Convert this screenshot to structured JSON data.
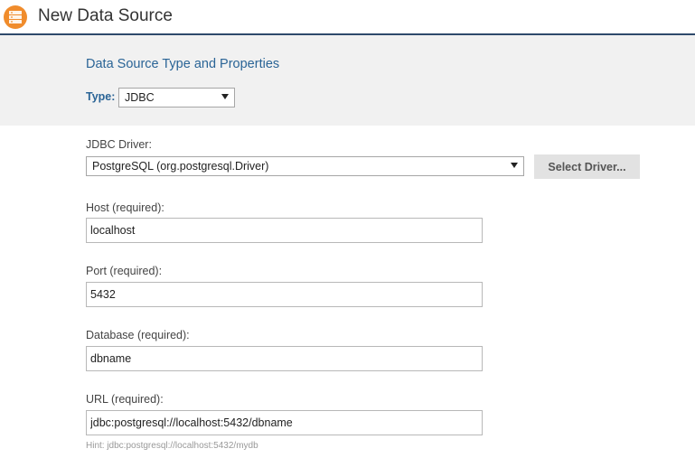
{
  "header": {
    "title": "New Data Source",
    "icon": "database-icon",
    "icon_color": "#f08c2c"
  },
  "type_section": {
    "title": "Data Source Type and Properties",
    "type_label": "Type:",
    "type_value": "JDBC"
  },
  "jdbc": {
    "driver_label": "JDBC Driver:",
    "driver_value": "PostgreSQL (org.postgresql.Driver)",
    "select_driver_label": "Select Driver..."
  },
  "fields": {
    "host_label": "Host (required):",
    "host_value": "localhost",
    "port_label": "Port (required):",
    "port_value": "5432",
    "database_label": "Database (required):",
    "database_value": "dbname",
    "url_label": "URL (required):",
    "url_value": "jdbc:postgresql://localhost:5432/dbname",
    "url_hint": "Hint: jdbc:postgresql://localhost:5432/mydb"
  },
  "colors": {
    "accent": "#2a6496",
    "header_rule": "#2e4a6b",
    "section_bg": "#f1f1f1"
  }
}
